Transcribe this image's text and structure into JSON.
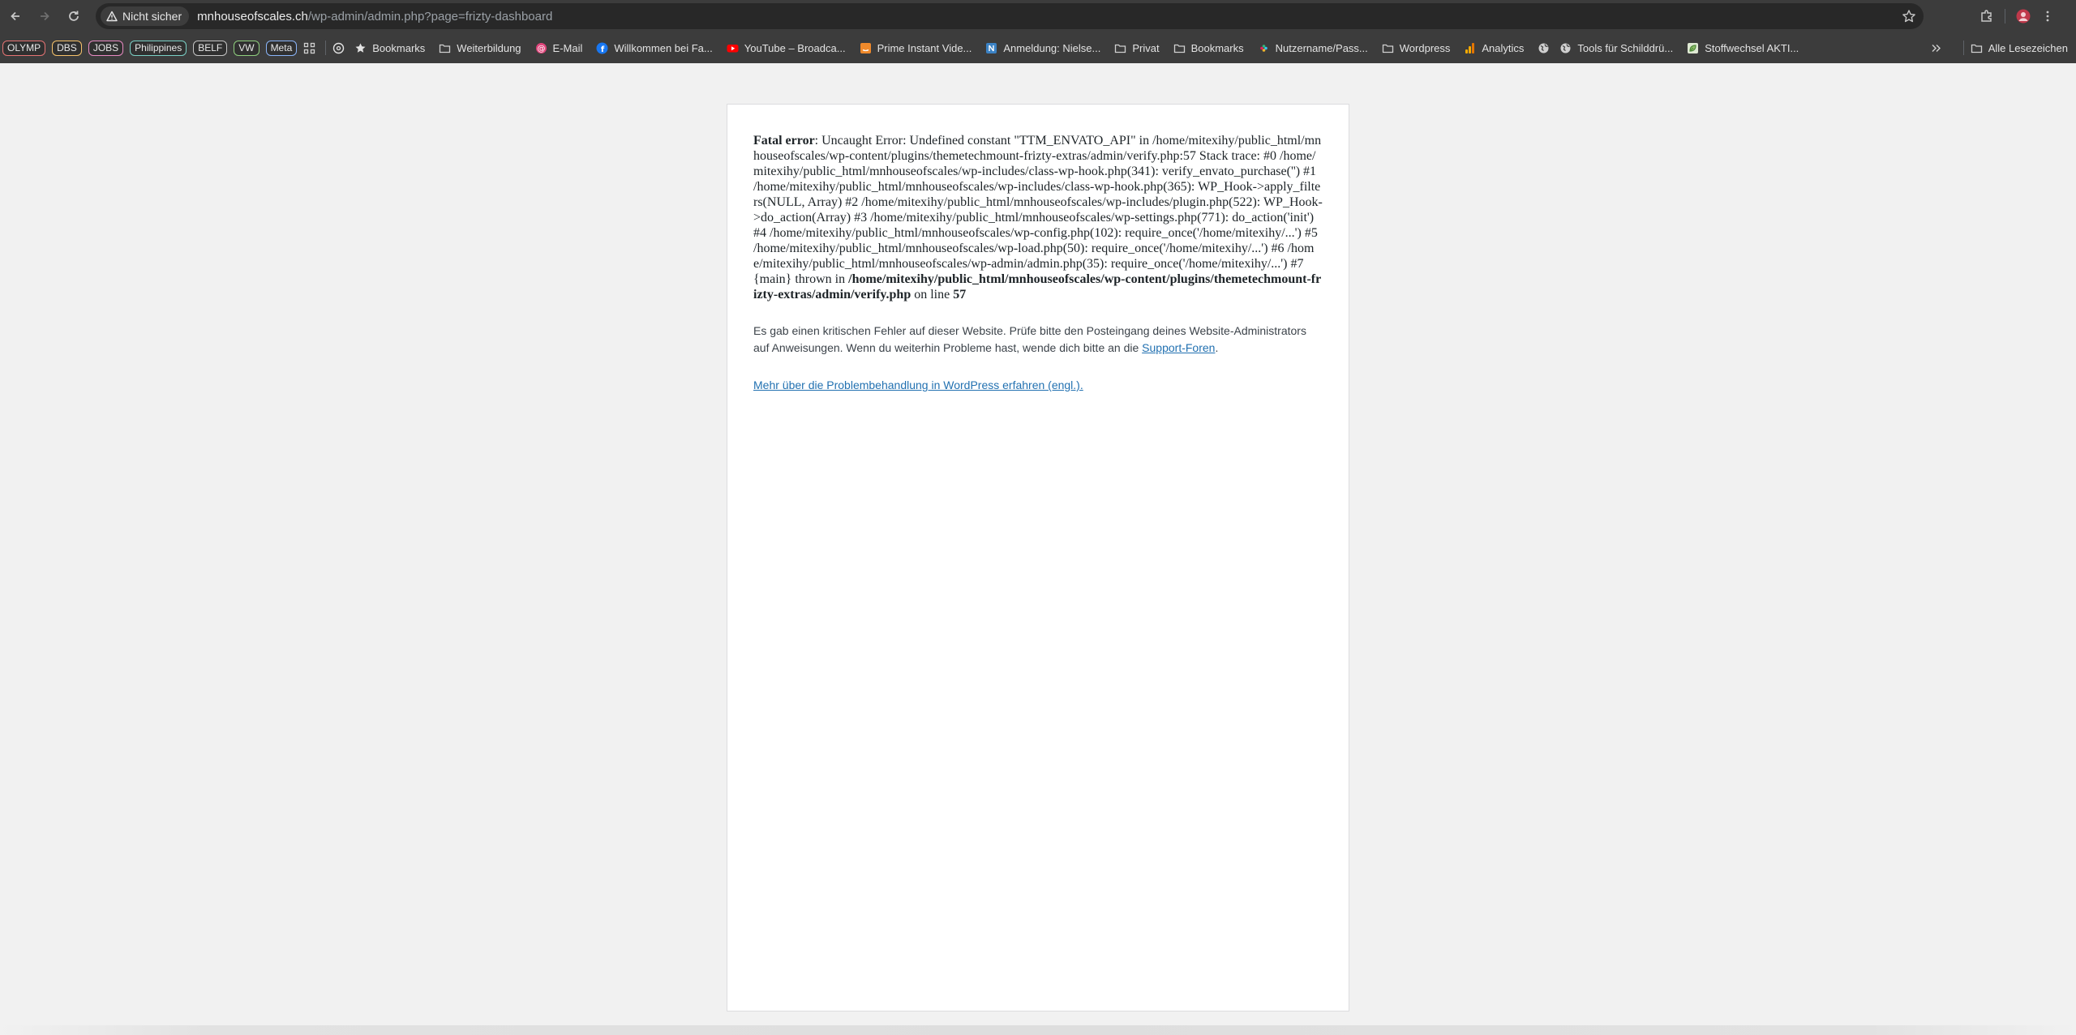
{
  "browser": {
    "security_label": "Nicht sicher",
    "url_host": "mnhouseofscales.ch",
    "url_path": "/wp-admin/admin.php?page=frizty-dashboard"
  },
  "bookmarks_bar": {
    "tags": [
      {
        "label": "OLYMP",
        "color": "#e57373"
      },
      {
        "label": "DBS",
        "color": "#f6c26b"
      },
      {
        "label": "JOBS",
        "color": "#e88ac2"
      },
      {
        "label": "Philippines",
        "color": "#7ad0c6"
      },
      {
        "label": "BELF",
        "color": "#c4c4c4"
      },
      {
        "label": "VW",
        "color": "#8fcf7e"
      },
      {
        "label": "Meta",
        "color": "#8ab4f8"
      }
    ],
    "items": [
      {
        "label": "Bookmarks",
        "icon": "star-icon"
      },
      {
        "label": "Weiterbildung",
        "icon": "folder-icon"
      },
      {
        "label": "E-Mail",
        "icon": "at-icon"
      },
      {
        "label": "Willkommen bei Fa...",
        "icon": "facebook-icon"
      },
      {
        "label": "YouTube – Broadca...",
        "icon": "youtube-icon"
      },
      {
        "label": "Prime Instant Vide...",
        "icon": "amazon-icon"
      },
      {
        "label": "Anmeldung: Nielse...",
        "icon": "nielsen-icon"
      },
      {
        "label": "Privat",
        "icon": "folder-icon"
      },
      {
        "label": "Bookmarks",
        "icon": "folder-icon"
      },
      {
        "label": "Nutzername/Pass...",
        "icon": "slack-icon"
      },
      {
        "label": "Wordpress",
        "icon": "folder-icon"
      },
      {
        "label": "Analytics",
        "icon": "analytics-icon"
      },
      {
        "label": "Tools für Schilddrü...",
        "icon": "globe-icon"
      },
      {
        "label": "Stoffwechsel AKTI...",
        "icon": "leaf-icon"
      }
    ],
    "all_bookmarks_label": "Alle Lesezeichen"
  },
  "error": {
    "label": "Fatal error",
    "message": ": Uncaught Error: Undefined constant \"TTM_ENVATO_API\" in /home/mitexihy/public_html/mnhouseofscales/wp-content/plugins/themetechmount-frizty-extras/admin/verify.php:57 Stack trace: #0 /home/mitexihy/public_html/mnhouseofscales/wp-includes/class-wp-hook.php(341): verify_envato_purchase('') #1 /home/mitexihy/public_html/mnhouseofscales/wp-includes/class-wp-hook.php(365): WP_Hook->apply_filters(NULL, Array) #2 /home/mitexihy/public_html/mnhouseofscales/wp-includes/plugin.php(522): WP_Hook->do_action(Array) #3 /home/mitexihy/public_html/mnhouseofscales/wp-settings.php(771): do_action('init') #4 /home/mitexihy/public_html/mnhouseofscales/wp-config.php(102): require_once('/home/mitexihy/...') #5 /home/mitexihy/public_html/mnhouseofscales/wp-load.php(50): require_once('/home/mitexihy/...') #6 /home/mitexihy/public_html/mnhouseofscales/wp-admin/admin.php(35): require_once('/home/mitexihy/...') #7 {main} thrown in ",
    "file": "/home/mitexihy/public_html/mnhouseofscales/wp-content/plugins/themetechmount-frizty-extras/admin/verify.php",
    "on_line_text": " on line ",
    "line": "57"
  },
  "wp_message": {
    "text": "Es gab einen kritischen Fehler auf dieser Website. Prüfe bitte den Posteingang deines Website-Administrators auf Anweisungen. Wenn du weiterhin Probleme hast, wende dich bitte an die ",
    "link_text": "Support-Foren",
    "suffix": "."
  },
  "more_link": "Mehr über die Problembehandlung in WordPress erfahren (engl.)."
}
